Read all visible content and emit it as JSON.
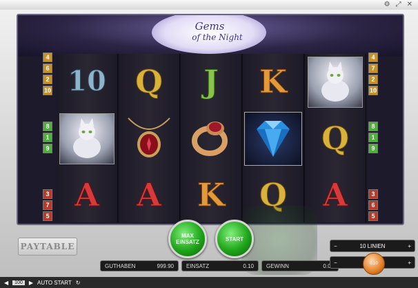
{
  "top_icons": {
    "settings": "⚙",
    "fullscreen": "⤢",
    "close": "✕"
  },
  "logo": {
    "line1": "Gems",
    "line2": "of the Night"
  },
  "reels": [
    [
      "10",
      "cat",
      "A"
    ],
    [
      "Q",
      "pendant",
      "A"
    ],
    [
      "J",
      "ring",
      "K"
    ],
    [
      "K",
      "diamond",
      "Q"
    ],
    [
      "cat",
      "Q",
      "A"
    ]
  ],
  "left_lines": {
    "top": [
      "4",
      "6",
      "2",
      "10"
    ],
    "middle": [
      "8",
      "1",
      "9"
    ],
    "bottom": [
      "3",
      "7",
      "5"
    ]
  },
  "right_lines": {
    "top": [
      "4",
      "7",
      "2",
      "10"
    ],
    "middle": [
      "8",
      "1",
      "9"
    ],
    "bottom": [
      "3",
      "6",
      "5"
    ]
  },
  "line_colors": {
    "top": "#c8922a",
    "middle": "#4fae3c",
    "bottom": "#b83a2a"
  },
  "buttons": {
    "max_bet": "MAX EINSATZ",
    "start": "START",
    "paytable": "PAYTABLE"
  },
  "status": {
    "balance_label": "GUTHABEN",
    "balance_value": "999.90",
    "bet_label": "EINSATZ",
    "bet_value": "0.10",
    "win_label": "GEWINN",
    "win_value": "0.00"
  },
  "lines_control": {
    "minus": "−",
    "label": "10 LINIEN",
    "plus": "+"
  },
  "coin_control": {
    "minus": "−",
    "plus": "+",
    "coin_label": "0.10"
  },
  "bottom_bar": {
    "arrow_left": "◀",
    "auto_count": "100",
    "arrow_right": "▶",
    "auto_start": "AUTO START",
    "loop": "↻"
  }
}
